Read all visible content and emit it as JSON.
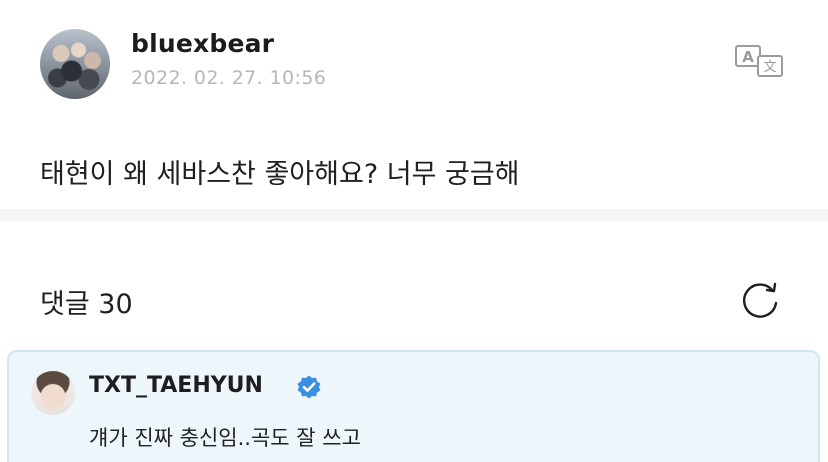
{
  "post": {
    "author": "bluexbear",
    "timestamp": "2022. 02. 27. 10:56",
    "body": "태현이 왜 세바스찬 좋아해요? 너무 궁금해",
    "translate_icon": "translate-icon"
  },
  "comments": {
    "title": "댓글 30",
    "refresh_icon": "refresh-icon",
    "items": [
      {
        "author": "TXT_TAEHYUN",
        "verified": true,
        "text": "걔가 진짜 충신임..곡도 잘 쓰고"
      }
    ]
  },
  "colors": {
    "verified_badge": "#3b8fe0",
    "artist_comment_bg": "#ecf6fb",
    "artist_comment_border": "#cfe6f1",
    "timestamp": "#b7b7b7",
    "divider": "#f4f5f7"
  }
}
